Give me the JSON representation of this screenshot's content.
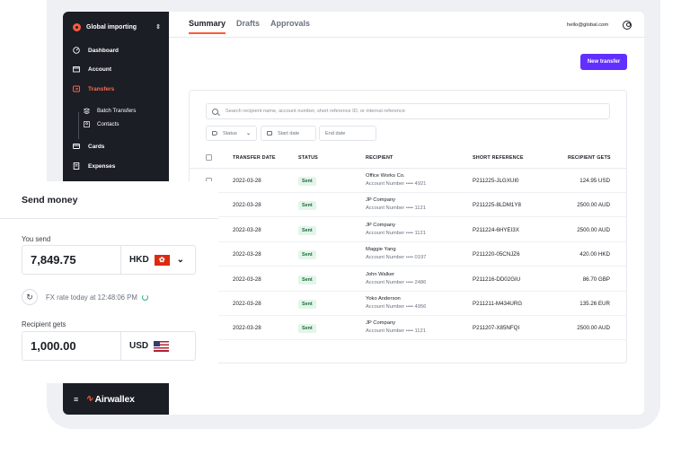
{
  "sidebar": {
    "org_name": "Global importing",
    "nav": [
      {
        "label": "Dashboard",
        "icon": "dashboard-icon"
      },
      {
        "label": "Account",
        "icon": "wallet-icon"
      },
      {
        "label": "Transfers",
        "icon": "transfer-icon",
        "active": true
      },
      {
        "label": "Cards",
        "icon": "card-icon"
      },
      {
        "label": "Expenses",
        "icon": "receipt-icon"
      }
    ],
    "sub_nav": [
      {
        "label": "Batch Transfers",
        "icon": "layers-icon"
      },
      {
        "label": "Contacts",
        "icon": "contacts-icon"
      }
    ],
    "brand": "Airwallex"
  },
  "tabs": [
    "Summary",
    "Drafts",
    "Approvals"
  ],
  "account": {
    "email": "hello@global.com"
  },
  "toolbar": {
    "new_transfer_label": "New transfer"
  },
  "search": {
    "placeholder": "Search recipient name, account number, short reference ID, or internal reference"
  },
  "filters": {
    "status": "Status",
    "start_date": "Start date",
    "end_date": "End date"
  },
  "table": {
    "columns": [
      "TRANSFER DATE",
      "STATUS",
      "RECIPIENT",
      "SHORT REFERENCE",
      "RECIPIENT GETS"
    ],
    "rows": [
      {
        "date": "2022-03-28",
        "status": "Sent",
        "name": "Office Works Co.",
        "account": "Account Number •••• 4921",
        "ref": "P211225-JLGXUI0",
        "amount": "124.95 USD"
      },
      {
        "date": "2022-03-28",
        "status": "Sent",
        "name": "JP Company",
        "account": "Account Number •••• 1121",
        "ref": "P211225-8LDM1Y8",
        "amount": "2500.00 AUD"
      },
      {
        "date": "2022-03-28",
        "status": "Sent",
        "name": "JP Company",
        "account": "Account Number •••• 1121",
        "ref": "P211224-6HYEI3X",
        "amount": "2500.00 AUD"
      },
      {
        "date": "2022-03-28",
        "status": "Sent",
        "name": "Maggie Yang",
        "account": "Account Number •••• 0197",
        "ref": "P211220-05CNJZ6",
        "amount": "420.00 HKD"
      },
      {
        "date": "2022-03-28",
        "status": "Sent",
        "name": "John Walker",
        "account": "Account Number •••• 2486",
        "ref": "P211216-DD02GIU",
        "amount": "86.70 GBP"
      },
      {
        "date": "2022-03-28",
        "status": "Sent",
        "name": "Yoko Anderson",
        "account": "Account Number •••• 4956",
        "ref": "P211211-M434URG",
        "amount": "135.26 EUR"
      },
      {
        "date": "2022-03-28",
        "status": "Sent",
        "name": "JP Company",
        "account": "Account Number •••• 1121",
        "ref": "P211207-X85NFQI",
        "amount": "2500.00 AUD"
      }
    ]
  },
  "send_money": {
    "title": "Send money",
    "you_send_label": "You send",
    "you_send_value": "7,849.75",
    "you_send_currency": "HKD",
    "fx_text": "FX rate today at 12:48:06 PM",
    "recipient_gets_label": "Recipient gets",
    "recipient_gets_value": "1,000.00",
    "recipient_gets_currency": "USD"
  },
  "colors": {
    "accent": "#612fff",
    "brand": "#ff5a3c",
    "sidebar": "#1b1e25",
    "success": "#1a6b3a"
  }
}
